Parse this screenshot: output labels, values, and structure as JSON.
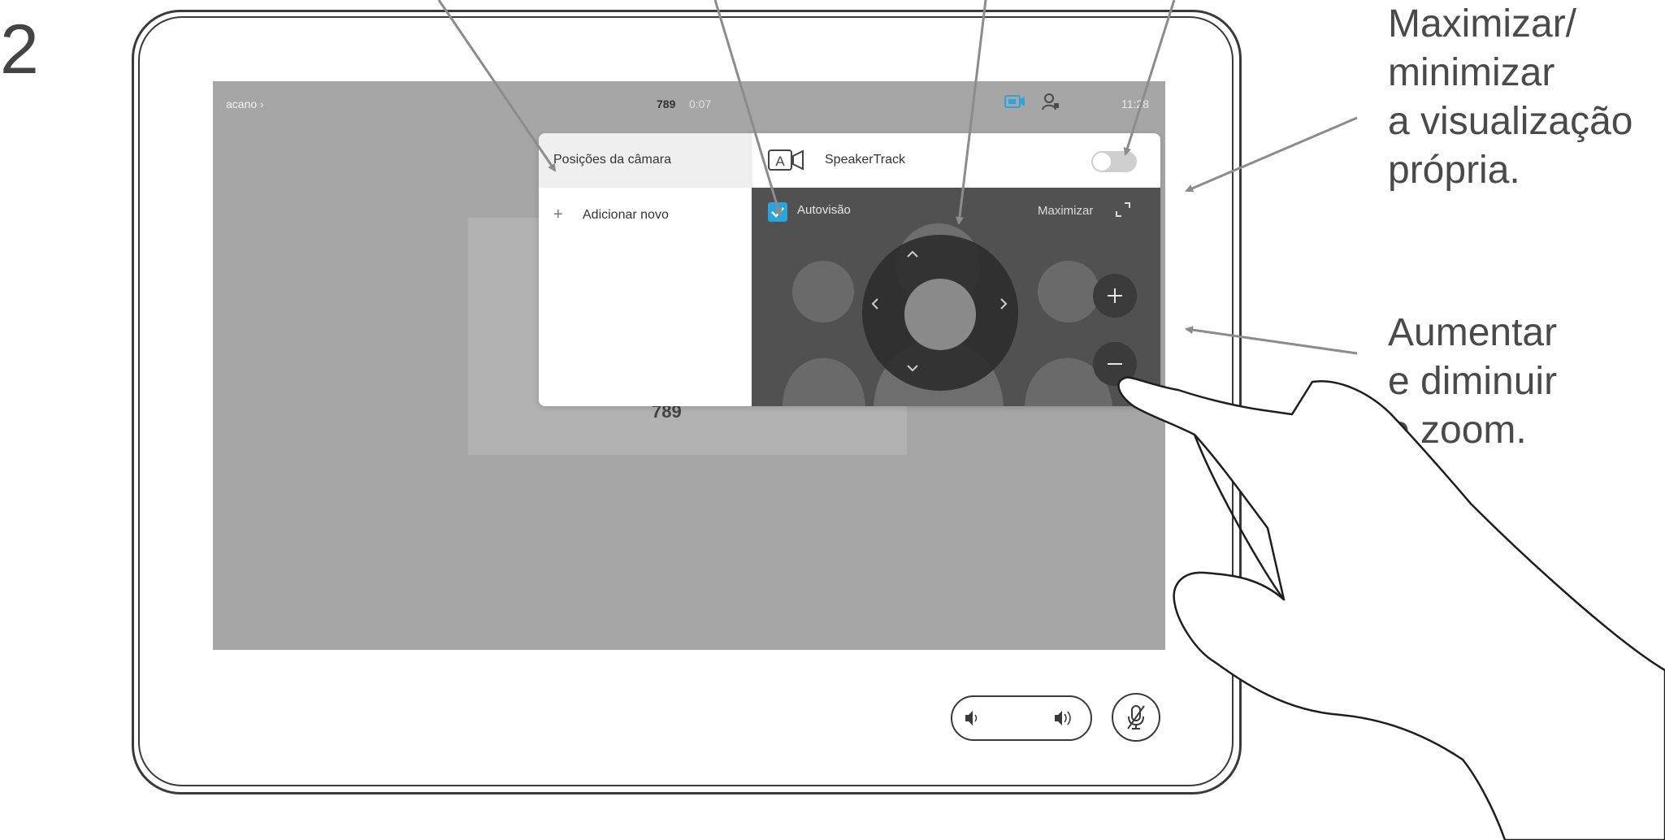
{
  "step": {
    "number": "2"
  },
  "callouts": {
    "selfview": "Maximizar/\nminimizar\na visualização\nprópria.",
    "zoom": "Aumentar\ne diminuir\no zoom."
  },
  "screen": {
    "topbar": {
      "site": "acano ›",
      "number": "789",
      "duration": "0:07",
      "clock": "11:28"
    },
    "remote_tile": {
      "number": "789"
    }
  },
  "camera_panel": {
    "presets": {
      "title": "Posições da câmara",
      "add_icon": "+",
      "add_label": "Adicionar novo"
    },
    "speakertrack": {
      "label": "SpeakerTrack",
      "icon": "speakertrack-icon",
      "enabled": false
    },
    "selfview": {
      "autoview_label": "Autovisão",
      "autoview_checked": true,
      "maximize_label": "Maximizar"
    },
    "zoom": {
      "in_icon": "plus-icon",
      "out_icon": "minus-icon"
    }
  },
  "colors": {
    "accent": "#2aa4dc",
    "screen_bg": "#a6a6a6",
    "selfview_bg": "#515151"
  }
}
